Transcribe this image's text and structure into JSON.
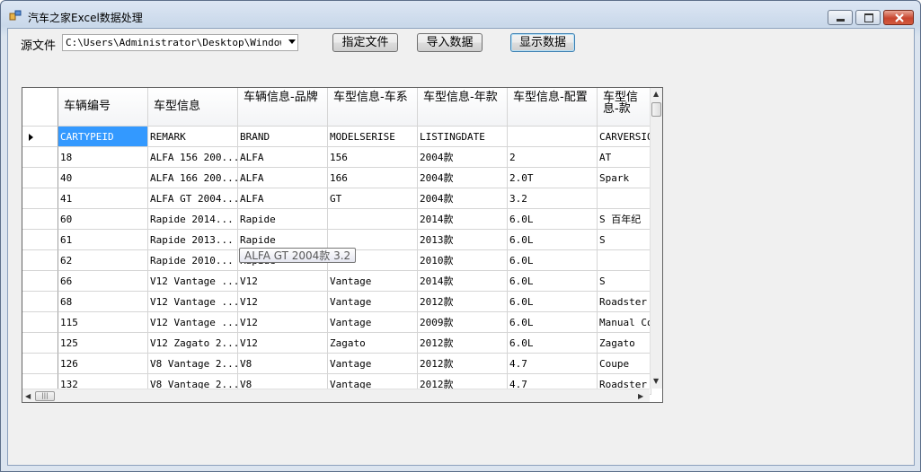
{
  "window": {
    "title": "汽车之家Excel数据处理"
  },
  "form": {
    "source_label": "源文件",
    "source_value": "C:\\Users\\Administrator\\Desktop\\WindowsFor",
    "buttons": {
      "choose_file": "指定文件",
      "import_data": "导入数据",
      "show_data": "显示数据"
    }
  },
  "grid": {
    "columns": [
      "车辆编号",
      "车型信息",
      "车辆信息-品牌",
      "车型信息-车系",
      "车型信息-年款",
      "车型信息-配置",
      "车型信息-款"
    ],
    "rows": [
      [
        "CARTYPEID",
        "REMARK",
        "BRAND",
        "MODELSERISE",
        "LISTINGDATE",
        "",
        "CARVERSIO"
      ],
      [
        "18",
        "ALFA 156 200...",
        "ALFA",
        "156",
        "2004款",
        "2",
        "AT"
      ],
      [
        "40",
        "ALFA 166 200...",
        "ALFA",
        "166",
        "2004款",
        "2.0T",
        "Spark"
      ],
      [
        "41",
        "ALFA GT 2004...",
        "ALFA",
        "GT",
        "2004款",
        "3.2",
        ""
      ],
      [
        "60",
        "Rapide 2014...",
        "Rapide",
        "",
        "2014款",
        "6.0L",
        "S  百年纪"
      ],
      [
        "61",
        "Rapide 2013...",
        "Rapide",
        "",
        "2013款",
        "6.0L",
        "S"
      ],
      [
        "62",
        "Rapide 2010...",
        "Rapide",
        "",
        "2010款",
        "6.0L",
        ""
      ],
      [
        "66",
        "V12 Vantage ...",
        "V12",
        "Vantage",
        "2014款",
        "6.0L",
        "S"
      ],
      [
        "68",
        "V12 Vantage ...",
        "V12",
        "Vantage",
        "2012款",
        "6.0L",
        "Roadster"
      ],
      [
        "115",
        "V12 Vantage ...",
        "V12",
        "Vantage",
        "2009款",
        "6.0L",
        "Manual Co"
      ],
      [
        "125",
        "V12 Zagato 2...",
        "V12",
        "Zagato",
        "2012款",
        "6.0L",
        "Zagato"
      ],
      [
        "126",
        "V8 Vantage 2...",
        "V8",
        "Vantage",
        "2012款",
        "4.7",
        "Coupe"
      ],
      [
        "132",
        "V8 Vantage 2...",
        "V8",
        "Vantage",
        "2012款",
        "4.7",
        "Roadster"
      ]
    ],
    "tooltip": "ALFA GT 2004款 3.2"
  },
  "icons": [
    "app-icon",
    "minimize-icon",
    "maximize-icon",
    "close-icon",
    "dropdown-arrow-icon",
    "row-selector-arrow-icon",
    "scroll-up-icon",
    "scroll-down-icon",
    "scroll-left-icon",
    "scroll-right-icon"
  ]
}
